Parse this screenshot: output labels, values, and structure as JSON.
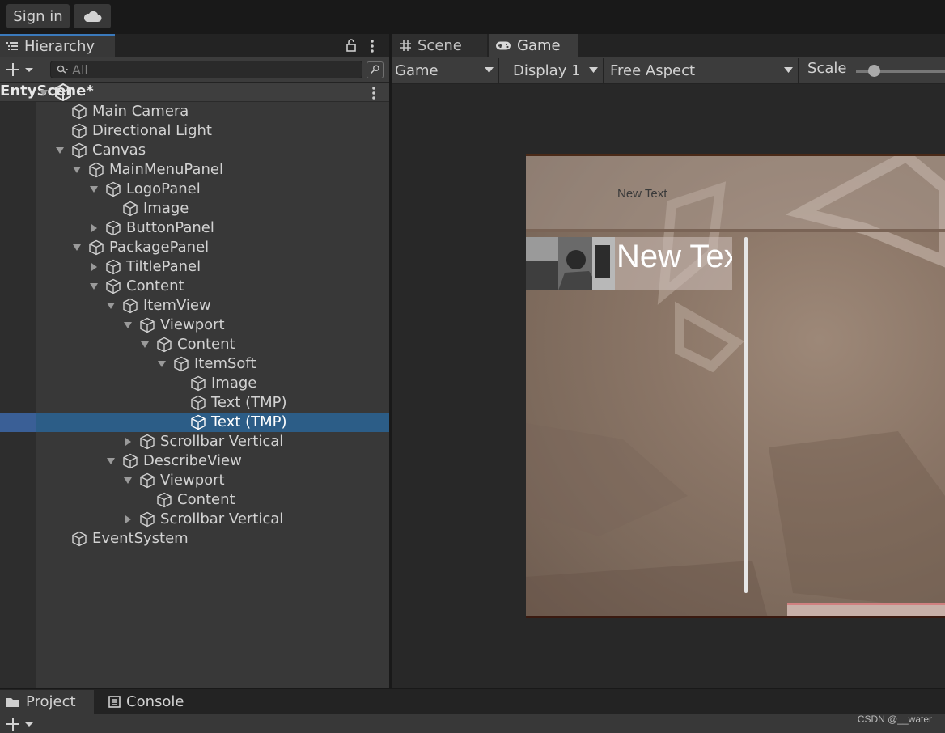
{
  "toolbar": {
    "sign_in": "Sign in",
    "cloud_icon": "cloud-icon"
  },
  "hierarchy": {
    "tab_label": "Hierarchy",
    "search_placeholder": "All",
    "scene_name": "EntyScene*",
    "items": [
      {
        "label": "Main Camera",
        "depth": 0,
        "arrow": "none"
      },
      {
        "label": "Directional Light",
        "depth": 0,
        "arrow": "none"
      },
      {
        "label": "Canvas",
        "depth": 0,
        "arrow": "expanded"
      },
      {
        "label": "MainMenuPanel",
        "depth": 1,
        "arrow": "expanded"
      },
      {
        "label": "LogoPanel",
        "depth": 2,
        "arrow": "expanded"
      },
      {
        "label": "Image",
        "depth": 3,
        "arrow": "none"
      },
      {
        "label": "ButtonPanel",
        "depth": 2,
        "arrow": "collapsed"
      },
      {
        "label": "PackagePanel",
        "depth": 1,
        "arrow": "expanded"
      },
      {
        "label": "TiltlePanel",
        "depth": 2,
        "arrow": "collapsed"
      },
      {
        "label": "Content",
        "depth": 2,
        "arrow": "expanded"
      },
      {
        "label": "ItemView",
        "depth": 3,
        "arrow": "expanded"
      },
      {
        "label": "Viewport",
        "depth": 4,
        "arrow": "expanded"
      },
      {
        "label": "Content",
        "depth": 5,
        "arrow": "expanded"
      },
      {
        "label": "ItemSoft",
        "depth": 6,
        "arrow": "expanded"
      },
      {
        "label": "Image",
        "depth": 7,
        "arrow": "none"
      },
      {
        "label": "Text (TMP)",
        "depth": 7,
        "arrow": "none"
      },
      {
        "label": "Text (TMP)",
        "depth": 7,
        "arrow": "none",
        "selected": true
      },
      {
        "label": "Scrollbar Vertical",
        "depth": 4,
        "arrow": "collapsed"
      },
      {
        "label": "DescribeView",
        "depth": 3,
        "arrow": "expanded"
      },
      {
        "label": "Viewport",
        "depth": 4,
        "arrow": "expanded"
      },
      {
        "label": "Content",
        "depth": 5,
        "arrow": "none"
      },
      {
        "label": "Scrollbar Vertical",
        "depth": 4,
        "arrow": "collapsed"
      },
      {
        "label": "EventSystem",
        "depth": 0,
        "arrow": "none"
      }
    ]
  },
  "game_view": {
    "tabs": {
      "scene": "Scene",
      "game": "Game"
    },
    "controls": {
      "mode": "Game",
      "display": "Display 1",
      "aspect": "Free Aspect",
      "scale_label": "Scale"
    },
    "canvas": {
      "title_text": "New Text",
      "item_text": "New Tex"
    }
  },
  "bottom_panel": {
    "tabs": {
      "project": "Project",
      "console": "Console"
    },
    "watermark": "CSDN @__water"
  },
  "colors": {
    "selection": "#2c5d87",
    "active_tab_accent": "#3a79bb",
    "panel_bg": "#383838"
  }
}
